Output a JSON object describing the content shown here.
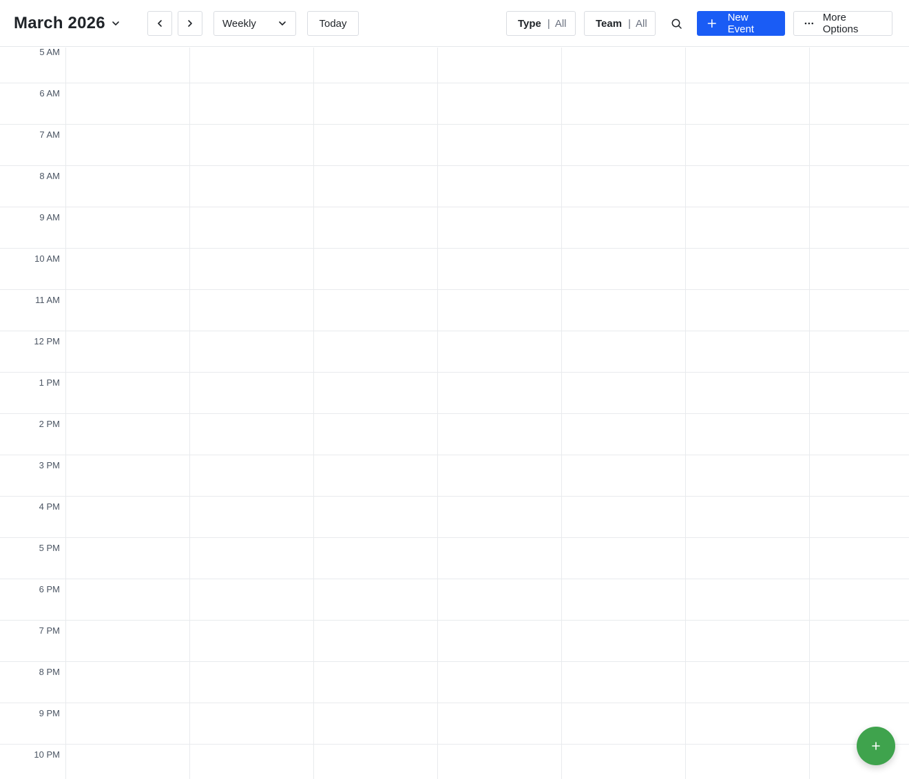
{
  "header": {
    "month_title": "March 2026",
    "view": "Weekly",
    "today_label": "Today",
    "type_filter": {
      "key": "Type",
      "value": "All"
    },
    "team_filter": {
      "key": "Team",
      "value": "All"
    },
    "new_event_label": "New Event",
    "more_options_label": "More Options"
  },
  "grid": {
    "hours": [
      "5 AM",
      "6 AM",
      "7 AM",
      "8 AM",
      "9 AM",
      "10 AM",
      "11 AM",
      "12 PM",
      "1 PM",
      "2 PM",
      "3 PM",
      "4 PM",
      "5 PM",
      "6 PM",
      "7 PM",
      "8 PM",
      "9 PM",
      "10 PM"
    ],
    "day_columns": 7
  },
  "colors": {
    "primary": "#1a5cf5",
    "fab": "#3fa34d",
    "grid_line": "#e8eaed"
  },
  "icons": {
    "month_dropdown": "chevron-down-icon",
    "prev": "chevron-left-icon",
    "next": "chevron-right-icon",
    "view_dropdown": "chevron-down-icon",
    "search": "search-icon",
    "new_event": "plus-icon",
    "more_options": "more-horizontal-icon",
    "fab": "plus-icon"
  }
}
